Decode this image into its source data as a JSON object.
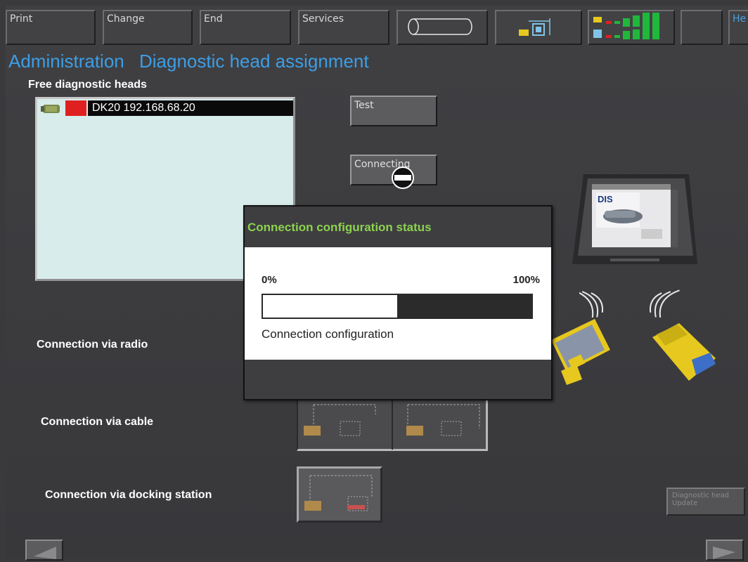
{
  "toolbar": {
    "print": "Print",
    "change": "Change",
    "end": "End",
    "services": "Services",
    "edge_button": "He"
  },
  "header": {
    "section": "Administration",
    "title": "Diagnostic head assignment"
  },
  "free_heads": {
    "label": "Free diagnostic heads",
    "items": [
      {
        "name": "DK20 192.168.68.20",
        "status_color": "#e02020"
      }
    ]
  },
  "buttons": {
    "test": "Test",
    "connecting": "Connecting",
    "head_update": "Diagnostic head Update"
  },
  "connection_labels": {
    "radio": "Connection via radio",
    "cable": "Connection via cable",
    "docking": "Connection via docking station"
  },
  "dialog": {
    "title": "Connection configuration status",
    "min_label": "0%",
    "max_label": "100%",
    "progress": 0.5,
    "status": "Connection configuration"
  },
  "laptop": {
    "screen_label": "DIS"
  },
  "colors": {
    "accent_blue": "#3d9ee4",
    "dialog_title_green": "#8cd24f",
    "status_green": "#1fb83a",
    "status_red": "#e02020",
    "head_yellow": "#e6c81e"
  }
}
